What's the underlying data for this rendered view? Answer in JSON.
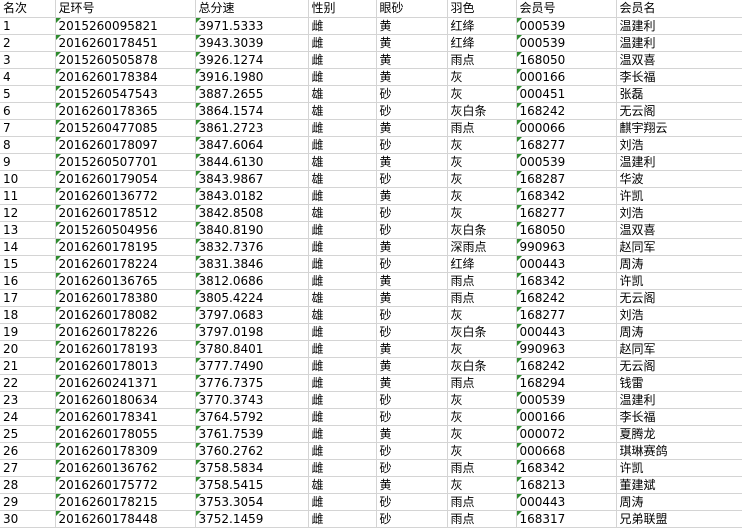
{
  "columns": [
    "名次",
    "足环号",
    "总分速",
    "性别",
    "眼砂",
    "羽色",
    "会员号",
    "会员名"
  ],
  "rows": [
    [
      "1",
      "2015260095821",
      "3971.5333",
      "雌",
      "黄",
      "红绛",
      "000539",
      "温建利"
    ],
    [
      "2",
      "2016260178451",
      "3943.3039",
      "雌",
      "黄",
      "红绛",
      "000539",
      "温建利"
    ],
    [
      "3",
      "2015260505878",
      "3926.1274",
      "雌",
      "黄",
      "雨点",
      "168050",
      "温双喜"
    ],
    [
      "4",
      "2016260178384",
      "3916.1980",
      "雌",
      "黄",
      "灰",
      "000166",
      "李长福"
    ],
    [
      "5",
      "2015260547543",
      "3887.2655",
      "雄",
      "砂",
      "灰",
      "000451",
      "张磊"
    ],
    [
      "6",
      "2016260178365",
      "3864.1574",
      "雄",
      "砂",
      "灰白条",
      "168242",
      "无云阁"
    ],
    [
      "7",
      "2015260477085",
      "3861.2723",
      "雌",
      "黄",
      "雨点",
      "000066",
      "麒宇翔云"
    ],
    [
      "8",
      "2016260178097",
      "3847.6064",
      "雌",
      "砂",
      "灰",
      "168277",
      "刘浩"
    ],
    [
      "9",
      "2015260507701",
      "3844.6130",
      "雄",
      "黄",
      "灰",
      "000539",
      "温建利"
    ],
    [
      "10",
      "2016260179054",
      "3843.9867",
      "雄",
      "砂",
      "灰",
      "168287",
      "华波"
    ],
    [
      "11",
      "2016260136772",
      "3843.0182",
      "雌",
      "黄",
      "灰",
      "168342",
      "许凯"
    ],
    [
      "12",
      "2016260178512",
      "3842.8508",
      "雄",
      "砂",
      "灰",
      "168277",
      "刘浩"
    ],
    [
      "13",
      "2015260504956",
      "3840.8190",
      "雌",
      "砂",
      "灰白条",
      "168050",
      "温双喜"
    ],
    [
      "14",
      "2016260178195",
      "3832.7376",
      "雌",
      "黄",
      "深雨点",
      "990963",
      "赵同军"
    ],
    [
      "15",
      "2016260178224",
      "3831.3846",
      "雌",
      "砂",
      "红绛",
      "000443",
      "周涛"
    ],
    [
      "16",
      "2016260136765",
      "3812.0686",
      "雌",
      "黄",
      "雨点",
      "168342",
      "许凯"
    ],
    [
      "17",
      "2016260178380",
      "3805.4224",
      "雄",
      "黄",
      "雨点",
      "168242",
      "无云阁"
    ],
    [
      "18",
      "2016260178082",
      "3797.0683",
      "雄",
      "砂",
      "灰",
      "168277",
      "刘浩"
    ],
    [
      "19",
      "2016260178226",
      "3797.0198",
      "雌",
      "砂",
      "灰白条",
      "000443",
      "周涛"
    ],
    [
      "20",
      "2016260178193",
      "3780.8401",
      "雌",
      "黄",
      "灰",
      "990963",
      "赵同军"
    ],
    [
      "21",
      "2016260178013",
      "3777.7490",
      "雌",
      "黄",
      "灰白条",
      "168242",
      "无云阁"
    ],
    [
      "22",
      "2016260241371",
      "3776.7375",
      "雌",
      "黄",
      "雨点",
      "168294",
      "钱雷"
    ],
    [
      "23",
      "2016260180634",
      "3770.3743",
      "雌",
      "砂",
      "灰",
      "000539",
      "温建利"
    ],
    [
      "24",
      "2016260178341",
      "3764.5792",
      "雌",
      "砂",
      "灰",
      "000166",
      "李长福"
    ],
    [
      "25",
      "2016260178055",
      "3761.7539",
      "雌",
      "黄",
      "灰",
      "000072",
      "夏腾龙"
    ],
    [
      "26",
      "2016260178309",
      "3760.2762",
      "雌",
      "砂",
      "灰",
      "000668",
      "琪琳赛鸽"
    ],
    [
      "27",
      "2016260136762",
      "3758.5834",
      "雌",
      "砂",
      "雨点",
      "168342",
      "许凯"
    ],
    [
      "28",
      "2016260175772",
      "3758.5415",
      "雄",
      "黄",
      "灰",
      "168213",
      "董建斌"
    ],
    [
      "29",
      "2016260178215",
      "3753.3054",
      "雌",
      "砂",
      "雨点",
      "000443",
      "周涛"
    ],
    [
      "30",
      "2016260178448",
      "3752.1459",
      "雌",
      "砂",
      "雨点",
      "168317",
      "兄弟联盟"
    ]
  ]
}
